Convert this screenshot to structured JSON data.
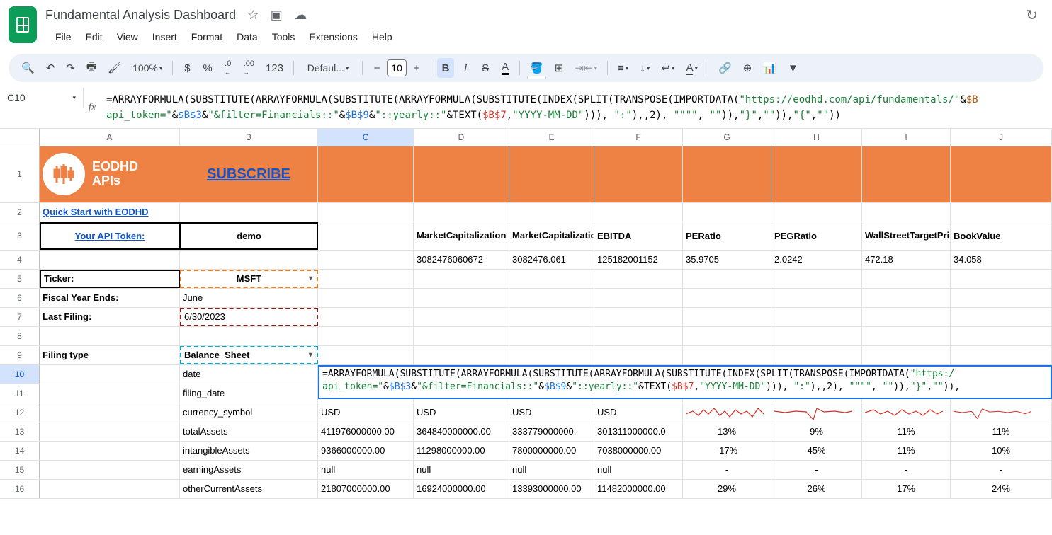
{
  "doc": {
    "title": "Fundamental Analysis Dashboard"
  },
  "menu": {
    "file": "File",
    "edit": "Edit",
    "view": "View",
    "insert": "Insert",
    "format": "Format",
    "data": "Data",
    "tools": "Tools",
    "extensions": "Extensions",
    "help": "Help"
  },
  "toolbar": {
    "zoom": "100%",
    "currency": "$",
    "pct": "%",
    "dec_dec": ".0",
    "dec_inc": ".00",
    "num": "123",
    "font": "Defaul...",
    "size": "10",
    "bold": "B",
    "italic": "I",
    "strike": "S",
    "textcolor": "A"
  },
  "namebox": "C10",
  "formula": {
    "p1": "=ARRAYFORMULA(SUBSTITUTE(ARRAYFORMULA(SUBSTITUTE(ARRAYFORMULA(SUBSTITUTE(INDEX(SPLIT(TRANSPOSE(IMPORTDATA(",
    "p2": "\"https://eodhd.com/api/fundamentals/\"",
    "p3": "&",
    "p4": "$B",
    "p5": "api_token=\"",
    "p6": "&",
    "p7": "$B$3",
    "p8": "&",
    "p9": "\"&filter=Financials::\"",
    "p10": "&",
    "p11": "$B$9",
    "p12": "&",
    "p13": "\"::yearly::\"",
    "p14": "&TEXT(",
    "p15": "$B$7",
    "p16": ",",
    "p17": "\"YYYY-MM-DD\"",
    "p18": "))), ",
    "p19": "\":\"",
    "p20": "),,2), ",
    "p21": "\"\"\"\"",
    "p22": ", ",
    "p23": "\"\"",
    "p24": ")),",
    "p25": "\"}\"",
    "p26": ",",
    "p27": "\"\"",
    "p28": ")),",
    "p29": "\"{\"",
    "p30": ",",
    "p31": "\"\"",
    "p32": "))"
  },
  "cols": {
    "A": "A",
    "B": "B",
    "C": "C",
    "D": "D",
    "E": "E",
    "F": "F",
    "G": "G",
    "H": "H",
    "I": "I",
    "J": "J"
  },
  "rows": [
    "1",
    "2",
    "3",
    "4",
    "5",
    "6",
    "7",
    "8",
    "9",
    "10",
    "11",
    "12",
    "13",
    "14",
    "15",
    "16"
  ],
  "brand": {
    "line1": "EODHD",
    "line2": "APIs",
    "subscribe": "SUBSCRIBE"
  },
  "labels": {
    "quickstart": "Quick Start with EODHD",
    "apitoken": "Your API Token:",
    "demo": "demo",
    "ticker": "Ticker:",
    "msft": "MSFT",
    "fye": "Fiscal Year Ends:",
    "june": "June",
    "lastfiling": "Last Filing:",
    "lfdate": "6/30/2023",
    "filingtype": "Filing type",
    "balance": "Balance_Sheet"
  },
  "metrics_h": {
    "mc": "MarketCapitalization",
    "mcm": "MarketCapitalizationMln",
    "ebitda": "EBITDA",
    "pe": "PERatio",
    "peg": "PEGRatio",
    "wst": "WallStreetTargetPrice",
    "bv": "BookValue"
  },
  "metrics_v": {
    "mc": "3082476060672",
    "mcm": "3082476.061",
    "ebitda": "125182001152",
    "pe": "35.9705",
    "peg": "2.0242",
    "wst": "472.18",
    "bv": "34.058"
  },
  "datarows": {
    "date": "date",
    "filing_date": "filing_date",
    "currency": "currency_symbol",
    "totalAssets": "totalAssets",
    "intangible": "intangibleAssets",
    "earning": "earningAssets",
    "otherCurrent": "otherCurrentAssets"
  },
  "usd": "USD",
  "t13": {
    "c": "411976000000.00",
    "d": "364840000000.00",
    "e": "333779000000.",
    "f": "301311000000.0",
    "g": "13%",
    "h": "9%",
    "i": "11%",
    "j": "11%"
  },
  "t14": {
    "c": "9366000000.00",
    "d": "11298000000.00",
    "e": "7800000000.00",
    "f": "7038000000.00",
    "g": "-17%",
    "h": "45%",
    "i": "11%",
    "j": "10%"
  },
  "t15": {
    "c": "null",
    "d": "null",
    "e": "null",
    "f": "null",
    "g": "-",
    "h": "-",
    "i": "-",
    "j": "-"
  },
  "t16": {
    "c": "21807000000.00",
    "d": "16924000000.00",
    "e": "13393000000.00",
    "f": "11482000000.00",
    "g": "29%",
    "h": "26%",
    "i": "17%",
    "j": "24%"
  },
  "overlay": {
    "l1a": "=ARRAYFORMULA(SUBSTITUTE(ARRAYFORMULA(SUBSTITUTE(ARRAYFORMULA(SUBSTITUTE(INDEX(SPLIT(TRANSPOSE(IMPORTDATA(",
    "l1b": "\"https:/",
    "l2a": "api_token=\"",
    "l2b": "&",
    "l2c": "$B$3",
    "l2d": "&",
    "l2e": "\"&filter=Financials::\"",
    "l2f": "&",
    "l2g": "$B$9",
    "l2h": "&",
    "l2i": "\"::yearly::\"",
    "l2j": "&TEXT(",
    "l2k": "$B$7",
    "l2l": ",",
    "l2m": "\"YYYY-MM-DD\"",
    "l2n": "))), ",
    "l2o": "\":\"",
    "l2p": "),,2), ",
    "l2q": "\"\"\"\"",
    "l2r": ", ",
    "l2s": "\"\"",
    "l2t": ")),",
    "l2u": "\"}\"",
    "l2v": ",",
    "l2w": "\"\"",
    "l2x": ")),"
  }
}
